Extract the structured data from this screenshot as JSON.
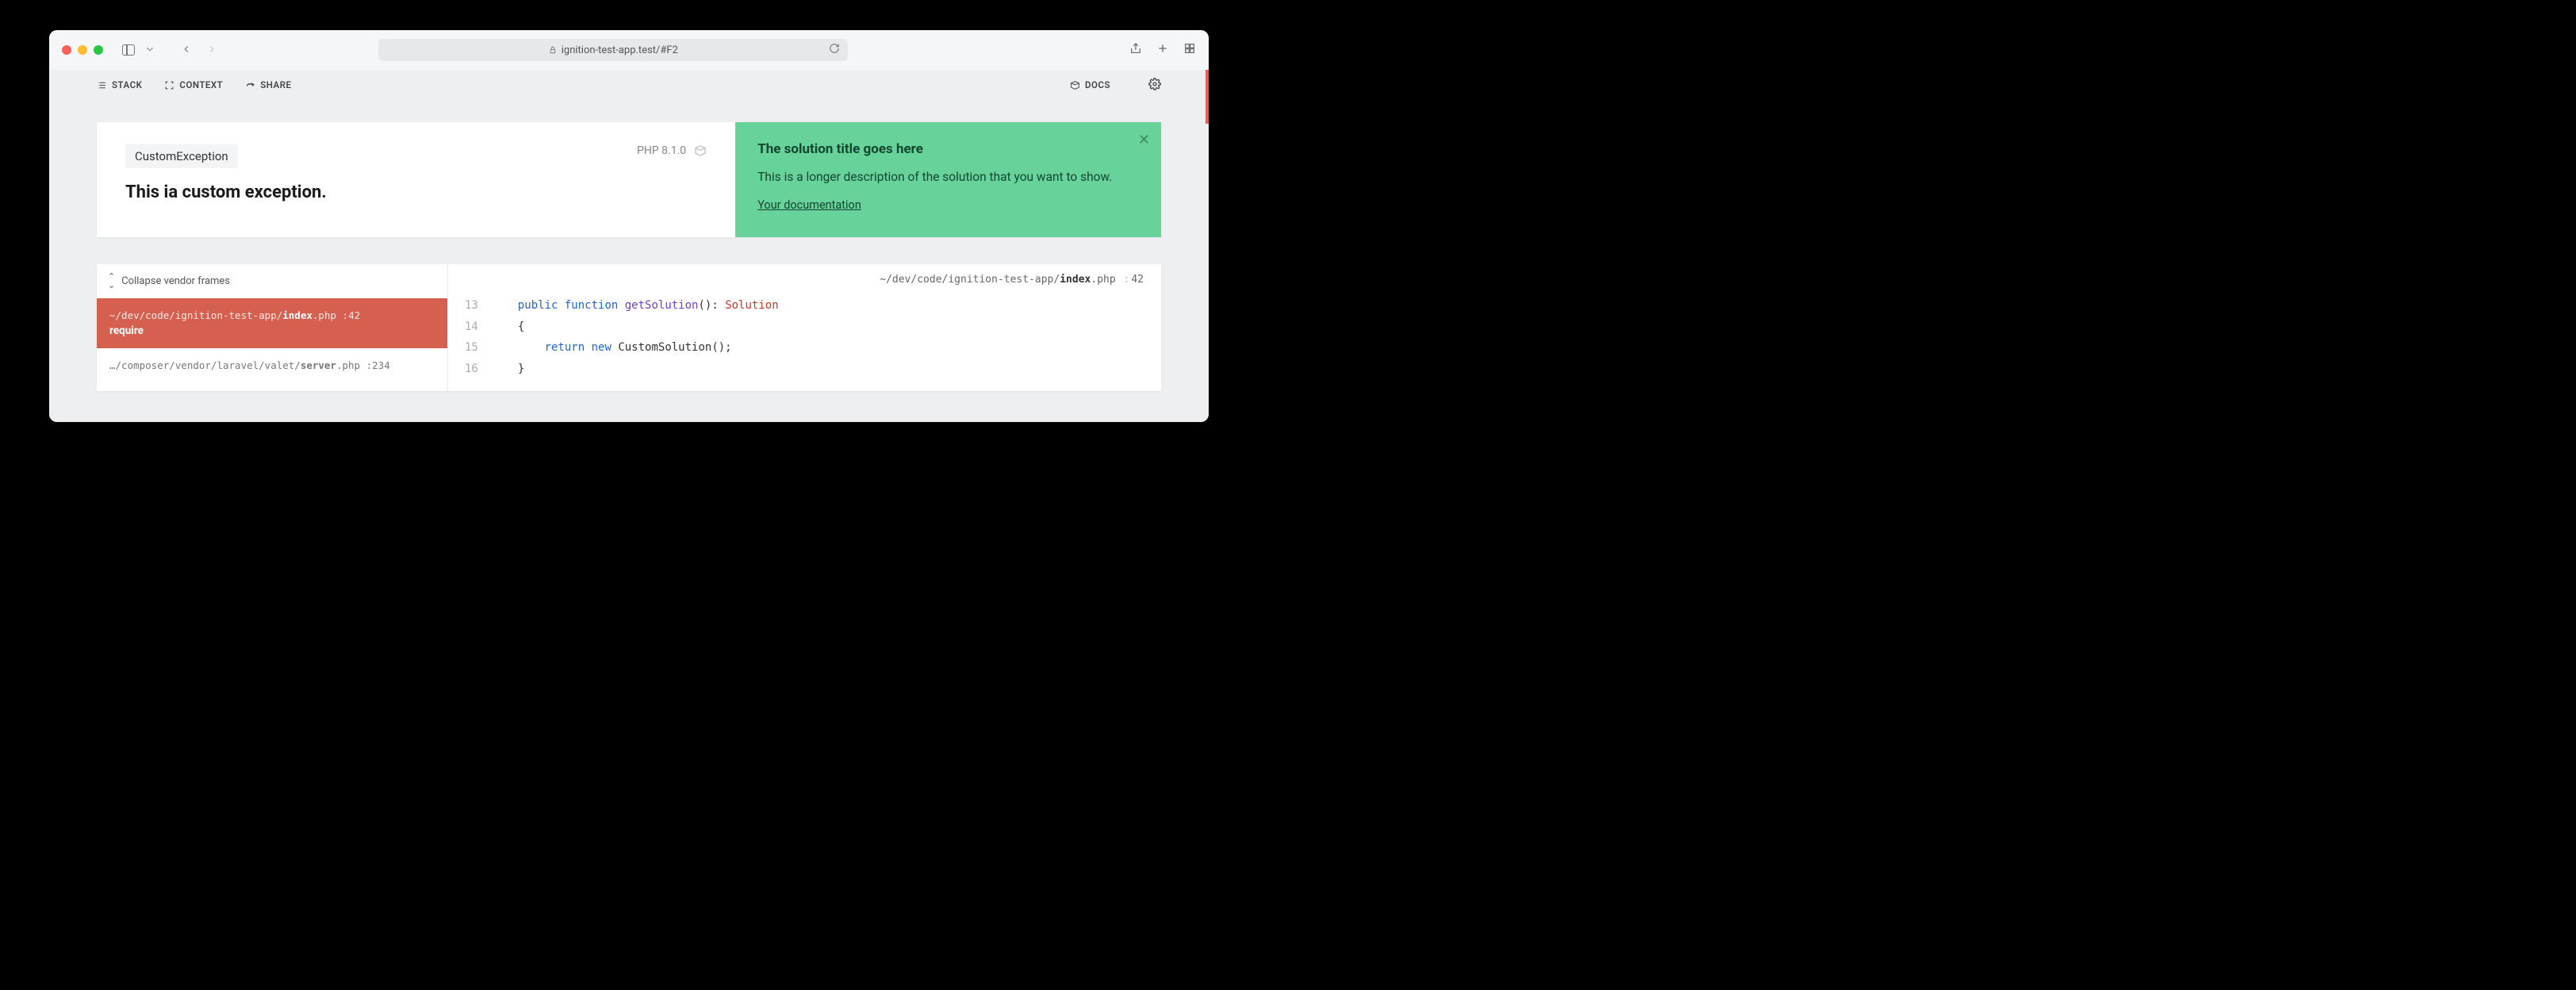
{
  "browser": {
    "url": "ignition-test-app.test/#F2"
  },
  "nav": {
    "stack": "STACK",
    "context": "CONTEXT",
    "share": "SHARE",
    "docs": "DOCS"
  },
  "exception": {
    "class": "CustomException",
    "message": "This ia custom exception.",
    "php_version": "PHP 8.1.0"
  },
  "solution": {
    "title": "The solution title goes here",
    "description": "This is a longer description of the solution that you want to show.",
    "link_label": "Your documentation"
  },
  "stack": {
    "collapse_label": "Collapse vendor frames",
    "frames": [
      {
        "path_prefix": "~/dev/code/ignition-test-app/",
        "file_bold": "index",
        "file_suffix": ".php",
        "line": "42",
        "function": "require"
      },
      {
        "path_prefix": "…/composer/vendor/laravel/valet/",
        "file_bold": "server",
        "file_suffix": ".php",
        "line": "234",
        "function": ""
      }
    ],
    "current_file": {
      "path_prefix": "~/dev/code/ignition-test-app/",
      "file_bold": "index",
      "file_suffix": ".php",
      "line": "42"
    },
    "code": {
      "l13_num": "13",
      "l13_kw1": "public",
      "l13_kw2": "function",
      "l13_fn": "getSolution",
      "l13_rest": "(): ",
      "l13_type": "Solution",
      "l14_num": "14",
      "l14_txt": "{",
      "l15_num": "15",
      "l15_kw1": "return",
      "l15_kw2": "new",
      "l15_rest": " CustomSolution();",
      "l16_num": "16",
      "l16_txt": "}"
    }
  }
}
